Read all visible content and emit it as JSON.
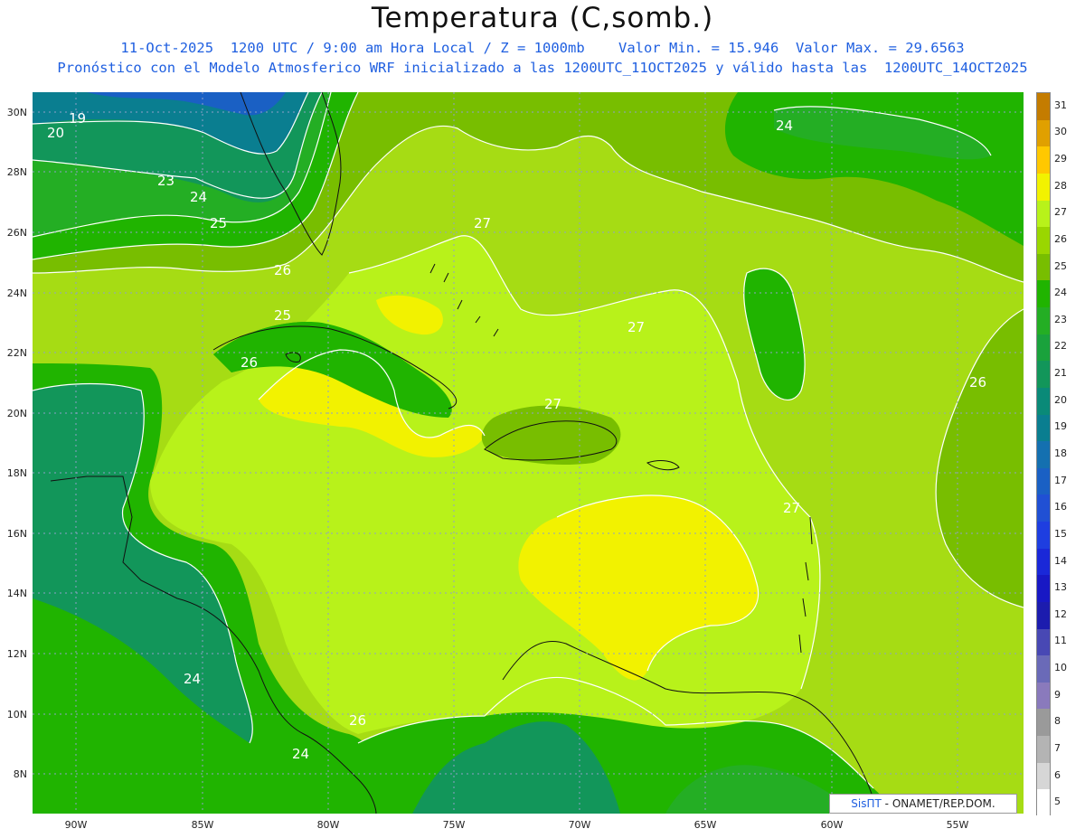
{
  "title": "Temperatura (C,somb.)",
  "subtitle_line1": "11-Oct-2025  1200 UTC / 9:00 am Hora Local / Z = 1000mb    Valor Min. = 15.946  Valor Max. = 29.6563",
  "subtitle_line2": "Pronóstico con el Modelo Atmosferico WRF inicializado a las 1200UTC_11OCT2025 y válido hasta las  1200UTC_14OCT2025",
  "lat_labels": [
    "30N",
    "28N",
    "26N",
    "24N",
    "22N",
    "20N",
    "18N",
    "16N",
    "14N",
    "12N",
    "10N",
    "8N"
  ],
  "lon_labels": [
    "90W",
    "85W",
    "80W",
    "75W",
    "70W",
    "65W",
    "60W",
    "55W"
  ],
  "legend": {
    "levels": [
      "31",
      "30",
      "29",
      "28",
      "27",
      "26",
      "25",
      "24",
      "23",
      "22",
      "21",
      "20",
      "19",
      "18",
      "17",
      "16",
      "15",
      "14",
      "13",
      "12",
      "11",
      "10",
      "9",
      "8",
      "7",
      "6",
      "5"
    ],
    "colors": [
      "#c47c00",
      "#e0a000",
      "#ffc800",
      "#f2f200",
      "#b8f21a",
      "#9ad600",
      "#78be00",
      "#20b400",
      "#24ae24",
      "#1aa23c",
      "#12965a",
      "#0a8a78",
      "#0a7e90",
      "#1470b0",
      "#1a60c4",
      "#2050d4",
      "#1e3ee0",
      "#1a28d8",
      "#1818c4",
      "#1c1cae",
      "#4848b4",
      "#6a6ab8",
      "#8a7abc",
      "#9a9a9a",
      "#b4b4b4",
      "#d6d6d6",
      "#ffffff"
    ]
  },
  "contour_labels": [
    "19",
    "20",
    "23",
    "24",
    "25",
    "26",
    "25",
    "26",
    "27",
    "27",
    "27",
    "26",
    "27",
    "24",
    "24",
    "24",
    "26"
  ],
  "credit": {
    "logo": "SisПT",
    "text": "- ONAMET/REP.DOM."
  }
}
